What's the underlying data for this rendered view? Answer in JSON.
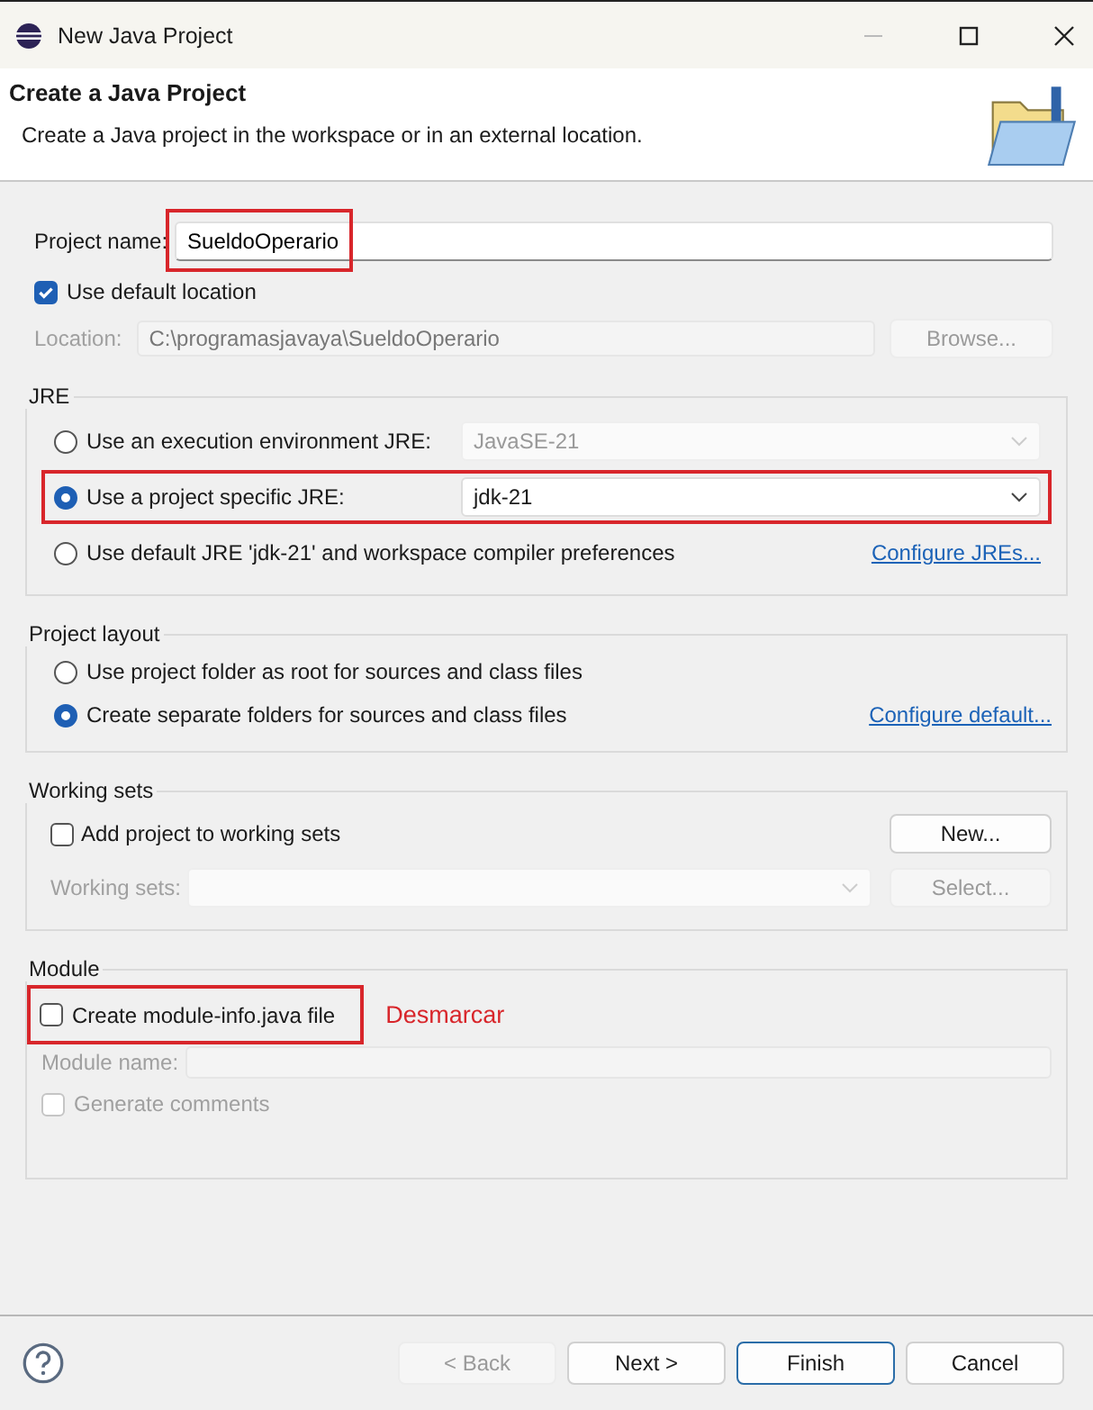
{
  "window": {
    "title": "New Java Project"
  },
  "header": {
    "title": "Create a Java Project",
    "description": "Create a Java project in the workspace or in an external location."
  },
  "project_name": {
    "label": "Project name:",
    "value": "SueldoOperario",
    "highlighted": true
  },
  "default_location": {
    "label": "Use default location",
    "checked": true
  },
  "location": {
    "label": "Location:",
    "value": "C:\\programasjavaya\\SueldoOperario",
    "disabled": true,
    "button": "Browse...",
    "button_disabled": true
  },
  "jre": {
    "title": "JRE",
    "options": [
      {
        "label": "Use an execution environment JRE:",
        "selected": false,
        "combo": "JavaSE-21",
        "combo_disabled": true
      },
      {
        "label": "Use a project specific JRE:",
        "selected": true,
        "combo": "jdk-21",
        "combo_disabled": false,
        "highlighted": true
      },
      {
        "label": "Use default JRE 'jdk-21' and workspace compiler preferences",
        "selected": false,
        "link": "Configure JREs..."
      }
    ]
  },
  "project_layout": {
    "title": "Project layout",
    "options": [
      {
        "label": "Use project folder as root for sources and class files",
        "selected": false
      },
      {
        "label": "Create separate folders for sources and class files",
        "selected": true,
        "link": "Configure default..."
      }
    ]
  },
  "working_sets": {
    "title": "Working sets",
    "add": {
      "label": "Add project to working sets",
      "checked": false
    },
    "new_button": "New...",
    "field_label": "Working sets:",
    "disabled": true,
    "select_button": "Select..."
  },
  "module": {
    "title": "Module",
    "create": {
      "label": "Create module-info.java file",
      "checked": false,
      "highlighted": true
    },
    "annotation": "Desmarcar",
    "name_label": "Module name:",
    "disabled": true,
    "comments": {
      "label": "Generate comments",
      "checked": false
    }
  },
  "buttons": [
    {
      "label": "< Back",
      "disabled": true,
      "default": false
    },
    {
      "label": "Next >",
      "disabled": false,
      "default": false
    },
    {
      "label": "Finish",
      "disabled": false,
      "default": true
    },
    {
      "label": "Cancel",
      "disabled": false,
      "default": false
    }
  ]
}
